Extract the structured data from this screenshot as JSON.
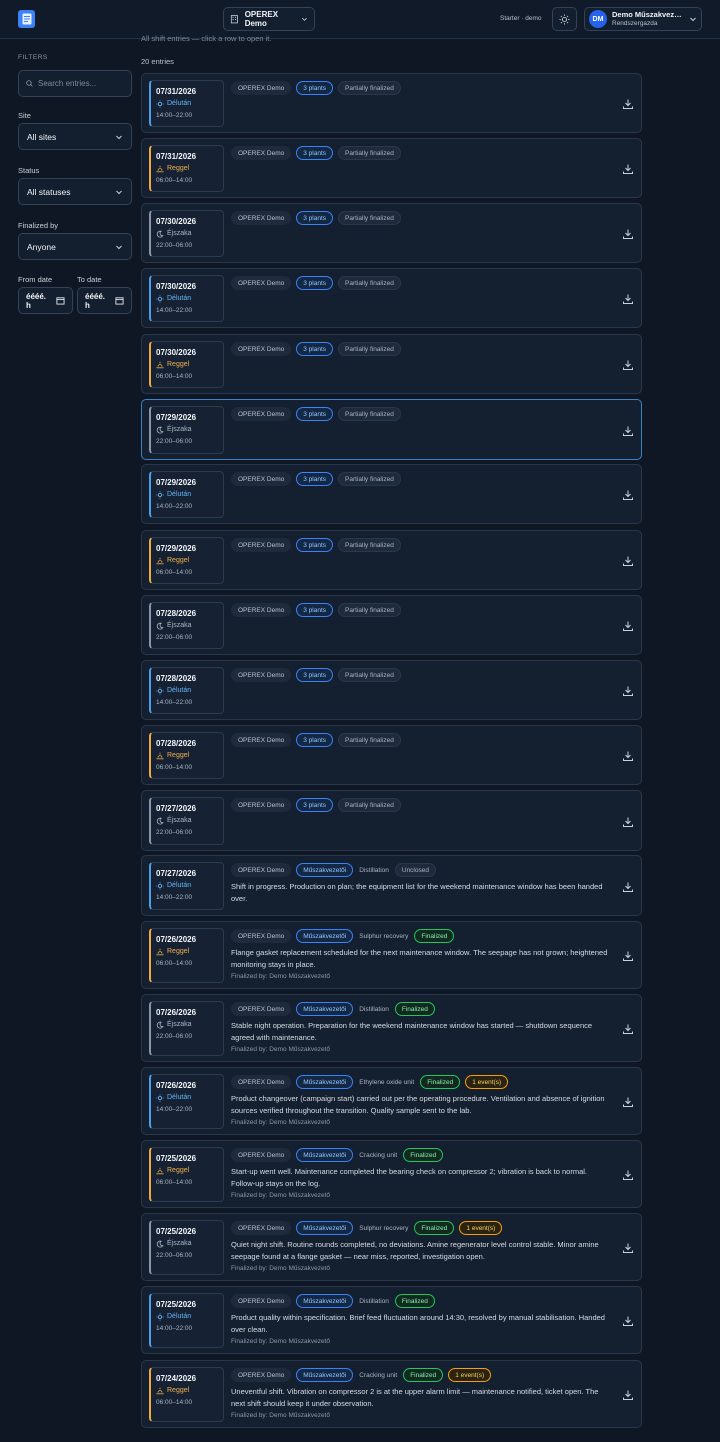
{
  "header": {
    "site_selector": "OPEREX Demo",
    "plan": "Starter · demo",
    "user_initials": "DM",
    "user_name": "Demo Műszakvez…",
    "user_role": "Rendszergazda"
  },
  "filters": {
    "heading": "FILTERS",
    "search_placeholder": "Search entries...",
    "site_label": "Site",
    "site_value": "All sites",
    "status_label": "Status",
    "status_value": "All statuses",
    "finalized_label": "Finalized by",
    "finalized_value": "Anyone",
    "from_label": "From date",
    "to_label": "To date",
    "from_value": "éééé. h",
    "to_value": "éééé. h"
  },
  "main": {
    "subtitle": "All shift entries — click a row to open it.",
    "count": "20 entries"
  },
  "entries": [
    {
      "date": "07/31/2026",
      "shift": "Délután",
      "kind": "eve",
      "time": "14:00–22:00",
      "site": "OPEREX Demo",
      "tag2": "3 plants",
      "tag2s": "blue",
      "unit": "",
      "status": "Partially finalized",
      "statuss": "gray",
      "event": "",
      "text": "",
      "fin": ""
    },
    {
      "date": "07/31/2026",
      "shift": "Reggel",
      "kind": "morn",
      "time": "06:00–14:00",
      "site": "OPEREX Demo",
      "tag2": "3 plants",
      "tag2s": "blue",
      "unit": "",
      "status": "Partially finalized",
      "statuss": "gray",
      "event": "",
      "text": "",
      "fin": ""
    },
    {
      "date": "07/30/2026",
      "shift": "Éjszaka",
      "kind": "night",
      "time": "22:00–06:00",
      "site": "OPEREX Demo",
      "tag2": "3 plants",
      "tag2s": "blue",
      "unit": "",
      "status": "Partially finalized",
      "statuss": "gray",
      "event": "",
      "text": "",
      "fin": ""
    },
    {
      "date": "07/30/2026",
      "shift": "Délután",
      "kind": "eve",
      "time": "14:00–22:00",
      "site": "OPEREX Demo",
      "tag2": "3 plants",
      "tag2s": "blue",
      "unit": "",
      "status": "Partially finalized",
      "statuss": "gray",
      "event": "",
      "text": "",
      "fin": ""
    },
    {
      "date": "07/30/2026",
      "shift": "Reggel",
      "kind": "morn",
      "time": "06:00–14:00",
      "site": "OPEREX Demo",
      "tag2": "3 plants",
      "tag2s": "blue",
      "unit": "",
      "status": "Partially finalized",
      "statuss": "gray",
      "event": "",
      "text": "",
      "fin": ""
    },
    {
      "date": "07/29/2026",
      "shift": "Éjszaka",
      "kind": "night",
      "time": "22:00–06:00",
      "site": "OPEREX Demo",
      "tag2": "3 plants",
      "tag2s": "blue",
      "unit": "",
      "status": "Partially finalized",
      "statuss": "gray",
      "event": "",
      "text": "",
      "fin": "",
      "highlight": true
    },
    {
      "date": "07/29/2026",
      "shift": "Délután",
      "kind": "eve",
      "time": "14:00–22:00",
      "site": "OPEREX Demo",
      "tag2": "3 plants",
      "tag2s": "blue",
      "unit": "",
      "status": "Partially finalized",
      "statuss": "gray",
      "event": "",
      "text": "",
      "fin": ""
    },
    {
      "date": "07/29/2026",
      "shift": "Reggel",
      "kind": "morn",
      "time": "06:00–14:00",
      "site": "OPEREX Demo",
      "tag2": "3 plants",
      "tag2s": "blue",
      "unit": "",
      "status": "Partially finalized",
      "statuss": "gray",
      "event": "",
      "text": "",
      "fin": ""
    },
    {
      "date": "07/28/2026",
      "shift": "Éjszaka",
      "kind": "night",
      "time": "22:00–06:00",
      "site": "OPEREX Demo",
      "tag2": "3 plants",
      "tag2s": "blue",
      "unit": "",
      "status": "Partially finalized",
      "statuss": "gray",
      "event": "",
      "text": "",
      "fin": ""
    },
    {
      "date": "07/28/2026",
      "shift": "Délután",
      "kind": "eve",
      "time": "14:00–22:00",
      "site": "OPEREX Demo",
      "tag2": "3 plants",
      "tag2s": "blue",
      "unit": "",
      "status": "Partially finalized",
      "statuss": "gray",
      "event": "",
      "text": "",
      "fin": ""
    },
    {
      "date": "07/28/2026",
      "shift": "Reggel",
      "kind": "morn",
      "time": "06:00–14:00",
      "site": "OPEREX Demo",
      "tag2": "3 plants",
      "tag2s": "blue",
      "unit": "",
      "status": "Partially finalized",
      "statuss": "gray",
      "event": "",
      "text": "",
      "fin": ""
    },
    {
      "date": "07/27/2026",
      "shift": "Éjszaka",
      "kind": "night",
      "time": "22:00–06:00",
      "site": "OPEREX Demo",
      "tag2": "3 plants",
      "tag2s": "blue",
      "unit": "",
      "status": "Partially finalized",
      "statuss": "gray",
      "event": "",
      "text": "",
      "fin": ""
    },
    {
      "date": "07/27/2026",
      "shift": "Délután",
      "kind": "eve",
      "time": "14:00–22:00",
      "site": "OPEREX Demo",
      "tag2": "Műszakvezetői",
      "tag2s": "blue",
      "unit": "Distillation",
      "status": "Unclosed",
      "statuss": "gray",
      "event": "",
      "text": "Shift in progress. Production on plan; the equipment list for the weekend maintenance window has been handed over.",
      "fin": ""
    },
    {
      "date": "07/26/2026",
      "shift": "Reggel",
      "kind": "morn",
      "time": "06:00–14:00",
      "site": "OPEREX Demo",
      "tag2": "Műszakvezetői",
      "tag2s": "blue",
      "unit": "Sulphur recovery",
      "status": "Finalized",
      "statuss": "green",
      "event": "",
      "text": "Flange gasket replacement scheduled for the next maintenance window. The seepage has not grown; heightened monitoring stays in place.",
      "fin": "Finalized by: Demo Műszakvezető"
    },
    {
      "date": "07/26/2026",
      "shift": "Éjszaka",
      "kind": "night",
      "time": "22:00–06:00",
      "site": "OPEREX Demo",
      "tag2": "Műszakvezetői",
      "tag2s": "blue",
      "unit": "Distillation",
      "status": "Finalized",
      "statuss": "green",
      "event": "",
      "text": "Stable night operation. Preparation for the weekend maintenance window has started — shutdown sequence agreed with maintenance.",
      "fin": "Finalized by: Demo Műszakvezető"
    },
    {
      "date": "07/26/2026",
      "shift": "Délután",
      "kind": "eve",
      "time": "14:00–22:00",
      "site": "OPEREX Demo",
      "tag2": "Műszakvezetői",
      "tag2s": "blue",
      "unit": "Ethylene oxide unit",
      "status": "Finalized",
      "statuss": "green",
      "event": "1 event(s)",
      "text": "Product changeover (campaign start) carried out per the operating procedure. Ventilation and absence of ignition sources verified throughout the transition. Quality sample sent to the lab.",
      "fin": "Finalized by: Demo Műszakvezető"
    },
    {
      "date": "07/25/2026",
      "shift": "Reggel",
      "kind": "morn",
      "time": "06:00–14:00",
      "site": "OPEREX Demo",
      "tag2": "Műszakvezetői",
      "tag2s": "blue",
      "unit": "Cracking unit",
      "status": "Finalized",
      "statuss": "green",
      "event": "",
      "text": "Start-up went well. Maintenance completed the bearing check on compressor 2; vibration is back to normal. Follow-up stays on the log.",
      "fin": "Finalized by: Demo Műszakvezető"
    },
    {
      "date": "07/25/2026",
      "shift": "Éjszaka",
      "kind": "night",
      "time": "22:00–06:00",
      "site": "OPEREX Demo",
      "tag2": "Műszakvezetői",
      "tag2s": "blue",
      "unit": "Sulphur recovery",
      "status": "Finalized",
      "statuss": "green",
      "event": "1 event(s)",
      "text": "Quiet night shift. Routine rounds completed, no deviations. Amine regenerator level control stable. Minor amine seepage found at a flange gasket — near miss, reported, investigation open.",
      "fin": "Finalized by: Demo Műszakvezető"
    },
    {
      "date": "07/25/2026",
      "shift": "Délután",
      "kind": "eve",
      "time": "14:00–22:00",
      "site": "OPEREX Demo",
      "tag2": "Műszakvezetői",
      "tag2s": "blue",
      "unit": "Distillation",
      "status": "Finalized",
      "statuss": "green",
      "event": "",
      "text": "Product quality within specification. Brief feed fluctuation around 14:30, resolved by manual stabilisation. Handed over clean.",
      "fin": "Finalized by: Demo Műszakvezető"
    },
    {
      "date": "07/24/2026",
      "shift": "Reggel",
      "kind": "morn",
      "time": "06:00–14:00",
      "site": "OPEREX Demo",
      "tag2": "Műszakvezetői",
      "tag2s": "blue",
      "unit": "Cracking unit",
      "status": "Finalized",
      "statuss": "green",
      "event": "1 event(s)",
      "text": "Uneventful shift. Vibration on compressor 2 is at the upper alarm limit — maintenance notified, ticket open. The next shift should keep it under observation.",
      "fin": "Finalized by: Demo Műszakvezető"
    }
  ]
}
